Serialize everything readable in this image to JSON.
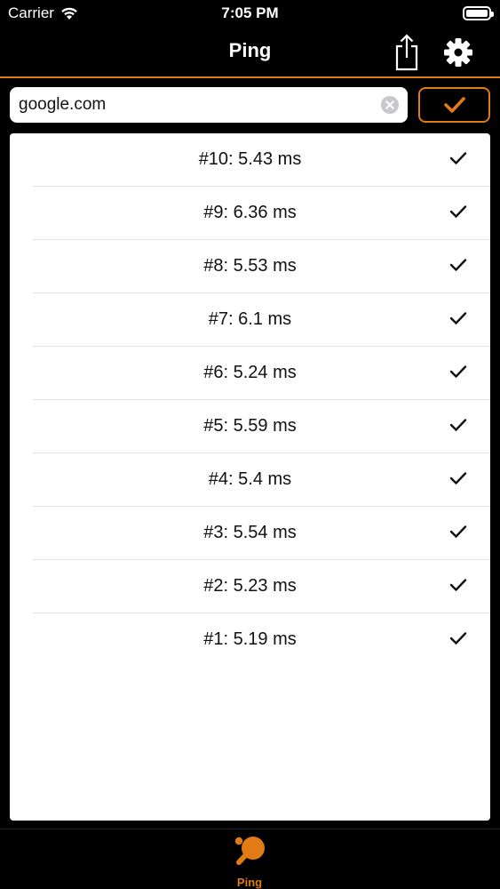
{
  "status_bar": {
    "carrier": "Carrier",
    "time": "7:05 PM",
    "wifi_icon": "wifi-icon",
    "battery_icon": "battery-icon"
  },
  "nav": {
    "title": "Ping",
    "share_icon": "share-icon",
    "settings_icon": "gear-icon"
  },
  "search": {
    "value": "google.com",
    "placeholder": "",
    "clear_icon": "clear-icon",
    "submit_icon": "checkmark-icon"
  },
  "results": [
    {
      "label": "#10: 5.43 ms",
      "status_icon": "checkmark-icon"
    },
    {
      "label": "#9: 6.36 ms",
      "status_icon": "checkmark-icon"
    },
    {
      "label": "#8: 5.53 ms",
      "status_icon": "checkmark-icon"
    },
    {
      "label": "#7: 6.1 ms",
      "status_icon": "checkmark-icon"
    },
    {
      "label": "#6: 5.24 ms",
      "status_icon": "checkmark-icon"
    },
    {
      "label": "#5: 5.59 ms",
      "status_icon": "checkmark-icon"
    },
    {
      "label": "#4: 5.4 ms",
      "status_icon": "checkmark-icon"
    },
    {
      "label": "#3: 5.54 ms",
      "status_icon": "checkmark-icon"
    },
    {
      "label": "#2: 5.23 ms",
      "status_icon": "checkmark-icon"
    },
    {
      "label": "#1: 5.19 ms",
      "status_icon": "checkmark-icon"
    }
  ],
  "tab_bar": {
    "items": [
      {
        "label": "Ping",
        "icon": "ping-pong-paddle-icon",
        "selected": true
      }
    ]
  },
  "colors": {
    "accent": "#e07b15",
    "background": "#000000",
    "list_background": "#ffffff"
  }
}
